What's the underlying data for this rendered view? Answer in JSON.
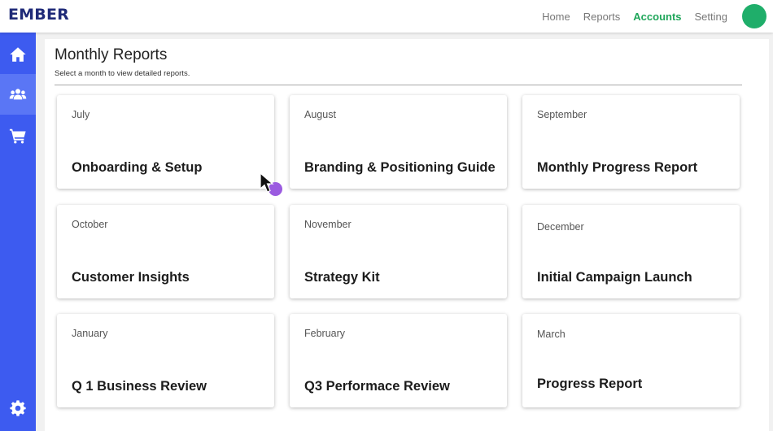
{
  "header": {
    "logo": "EMBER",
    "nav": [
      {
        "label": "Home"
      },
      {
        "label": "Reports"
      },
      {
        "label": "Accounts",
        "active": true
      },
      {
        "label": "Setting"
      }
    ],
    "avatar_color": "#1fae6a",
    "active_color": "#1fa65a"
  },
  "sidebar": {
    "items": [
      {
        "icon": "home-icon"
      },
      {
        "icon": "users-icon",
        "active": true
      },
      {
        "icon": "cart-icon"
      }
    ],
    "bottom_icon": "gear-icon",
    "color": "#3d5bf0"
  },
  "main": {
    "title": "Monthly Reports",
    "subtitle": "Select a month to view detailed reports.",
    "cards": [
      {
        "month": "July",
        "name": "Onboarding & Setup"
      },
      {
        "month": "August",
        "name": "Branding & Positioning Guide"
      },
      {
        "month": "September",
        "name": "Monthly Progress Report"
      },
      {
        "month": "October",
        "name": "Customer Insights"
      },
      {
        "month": "November",
        "name": "Strategy Kit"
      },
      {
        "month": "December",
        "name": "Initial Campaign Launch"
      },
      {
        "month": "January",
        "name": "Q 1 Business Review"
      },
      {
        "month": "February",
        "name": "Q3 Performace Review"
      },
      {
        "month": "March",
        "name": "Progress Report"
      }
    ]
  }
}
